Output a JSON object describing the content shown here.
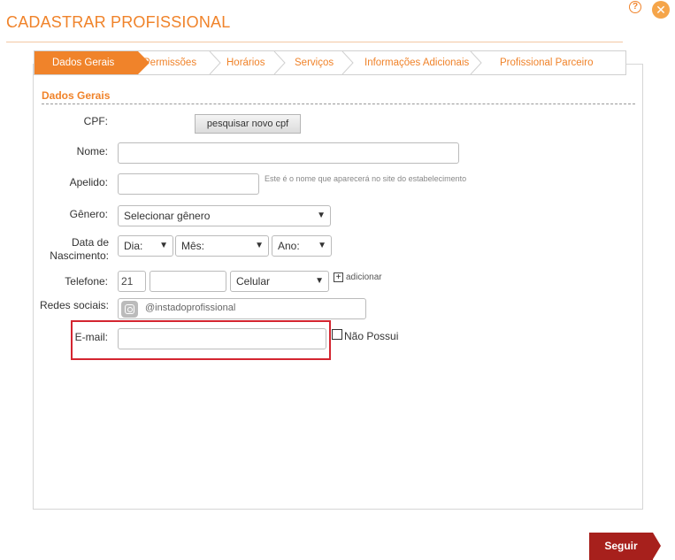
{
  "header": {
    "title": "CADASTRAR PROFISSIONAL",
    "help_icon": "?",
    "close_icon": "✕"
  },
  "tabs": [
    {
      "label": "Dados Gerais",
      "active": true
    },
    {
      "label": "Permissões",
      "active": false
    },
    {
      "label": "Horários",
      "active": false
    },
    {
      "label": "Serviços",
      "active": false
    },
    {
      "label": "Informações Adicionais",
      "active": false
    },
    {
      "label": "Profissional Parceiro",
      "active": false
    }
  ],
  "section": {
    "title": "Dados Gerais"
  },
  "form": {
    "cpf_label": "CPF:",
    "cpf_button": "pesquisar novo cpf",
    "nome_label": "Nome:",
    "nome_value": "",
    "apelido_label": "Apelido:",
    "apelido_value": "",
    "apelido_hint": "Este é o nome que aparecerá no site do estabelecimento",
    "genero_label": "Gênero:",
    "genero_selected": "Selecionar gênero",
    "nascimento_label_1": "Data de",
    "nascimento_label_2": "Nascimento:",
    "dia_selected": "Dia:",
    "mes_selected": "Mês:",
    "ano_selected": "Ano:",
    "telefone_label": "Telefone:",
    "telefone_ddd": "21",
    "telefone_numero": "",
    "telefone_tipo": "Celular",
    "adicionar_label": "adicionar",
    "redes_label": "Redes sociais:",
    "instagram_placeholder": "@instadoprofissional",
    "email_label": "E-mail:",
    "email_value": "",
    "nao_possui_label": "Não Possui"
  },
  "footer": {
    "next_button": "Seguir"
  },
  "colors": {
    "accent": "#f0832a",
    "next_button": "#a7201c",
    "highlight": "#d42530"
  }
}
